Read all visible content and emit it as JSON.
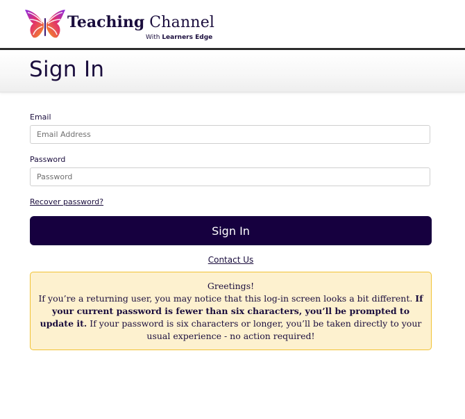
{
  "header": {
    "brand_name_bold": "Teaching",
    "brand_name_light": "Channel",
    "brand_sub_prefix": "With",
    "brand_sub_bold": "Learners Edge"
  },
  "page": {
    "title": "Sign In"
  },
  "form": {
    "email_label": "Email",
    "email_placeholder": "Email Address",
    "email_value": "",
    "password_label": "Password",
    "password_placeholder": "Password",
    "password_value": "",
    "recover_link": "Recover password?",
    "submit_label": "Sign In",
    "contact_link": "Contact Us"
  },
  "notice": {
    "heading": "Greetings!",
    "text_1": "If you’re a returning user, you may notice that this log-in screen looks a bit different.",
    "text_bold": "If your current password is fewer than six characters, you’ll be prompted to update it.",
    "text_2": "If your password is six characters or longer, you’ll be taken directly to your usual experience - no action required!"
  },
  "colors": {
    "brand_navy": "#16003f",
    "notice_background": "#fdf1cf",
    "notice_border": "#f1c232"
  },
  "icons": {
    "logo": "butterfly-logo-icon"
  }
}
